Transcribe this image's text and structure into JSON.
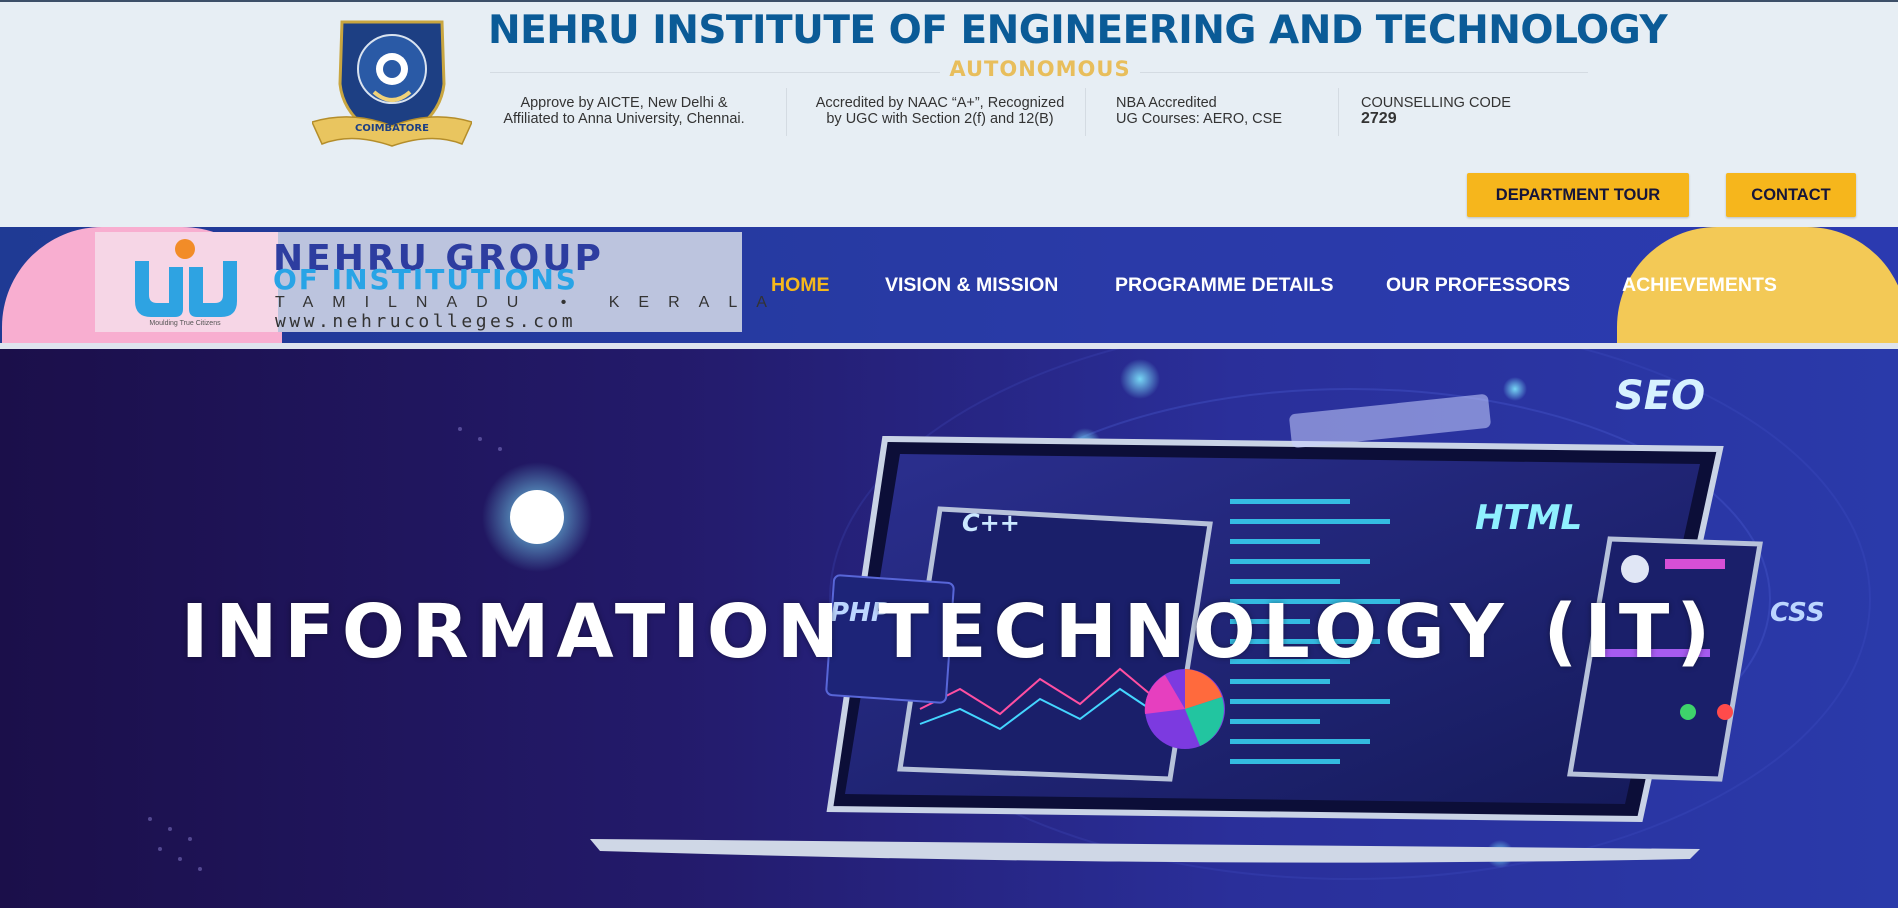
{
  "header": {
    "title": "NEHRU INSTITUTE OF ENGINEERING AND TECHNOLOGY",
    "subtitle": "AUTONOMOUS",
    "crest_text": "COIMBATORE",
    "info": [
      {
        "line1": "Approve by AICTE, New Delhi &",
        "line2": "Affiliated to Anna University, Chennai."
      },
      {
        "line1": "Accredited by NAAC “A+”, Recognized",
        "line2": "by UGC with Section 2(f) and 12(B)"
      },
      {
        "line1": "NBA Accredited",
        "line2": "UG Courses: AERO, CSE"
      },
      {
        "line1": "COUNSELLING CODE",
        "line2": "2729"
      }
    ],
    "buttons": {
      "tour": "DEPARTMENT TOUR",
      "contact": "CONTACT"
    }
  },
  "nav": {
    "logo": {
      "line1": "NEHRU GROUP",
      "line2": "OF INSTITUTIONS",
      "line3": "TAMILNADU • KERALA",
      "line4": "www.nehrucolleges.com",
      "tagline": "Moulding True Citizens"
    },
    "items": [
      {
        "label": "HOME",
        "active": true
      },
      {
        "label": "VISION & MISSION",
        "active": false
      },
      {
        "label": "PROGRAMME DETAILS",
        "active": false
      },
      {
        "label": "OUR PROFESSORS",
        "active": false
      },
      {
        "label": "ACHIEVEMENTS",
        "active": false
      }
    ]
  },
  "hero": {
    "title": "INFORMATION TECHNOLOGY (IT)",
    "image_tags": [
      "SEO",
      "HTML",
      "C++",
      "PHP",
      "CSS"
    ]
  },
  "colors": {
    "title_blue": "#0b5b97",
    "accent_yellow": "#f6b61c",
    "nav_blue": "#2a3aa8",
    "autonomous_gold": "#e8be5c"
  }
}
